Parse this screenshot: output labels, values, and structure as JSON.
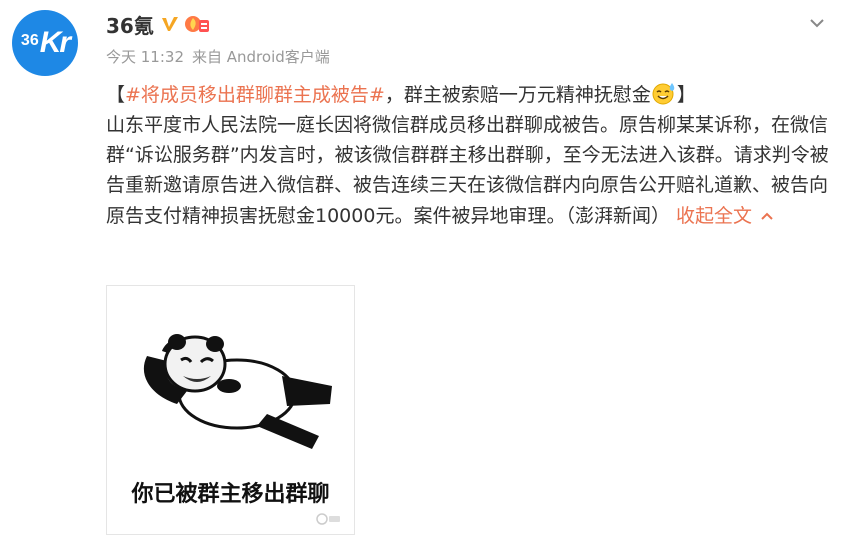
{
  "profile": {
    "avatar_text_left": "36",
    "avatar_text_right": "Kr",
    "name": "36氪"
  },
  "meta": {
    "time": "今天 11:32",
    "source": "来自 Android客户端"
  },
  "post": {
    "open_bracket": "【",
    "hashtag": "#将成员移出群聊群主成被告#",
    "headline": "，群主被索赔一万元精神抚慰金",
    "close_bracket": "】",
    "body": "山东平度市人民法院一庭长因将微信群成员移出群聊成被告。原告柳某某诉称，在微信群“诉讼服务群”内发言时，被该微信群群主移出群聊，至今无法进入该群。请求判令被告重新邀请原告进入微信群、被告连续三天在该微信群内向原告公开赔礼道歉、被告向原告支付精神损害抚慰金10000元。案件被异地审理。（澎湃新闻）",
    "collapse_label": "收起全文"
  },
  "image": {
    "caption": "你已被群主移出群聊"
  },
  "icons": {
    "verified": "verified-v-icon",
    "badge": "fire-badge-icon",
    "emoji": "sweat-smile-emoji-icon",
    "menu": "chevron-down-icon",
    "collapse": "chevron-up-icon"
  },
  "colors": {
    "link": "#eb7350",
    "avatar_bg": "#1e88e5",
    "verified": "#f5a623",
    "text": "#333333",
    "meta": "#999999"
  }
}
